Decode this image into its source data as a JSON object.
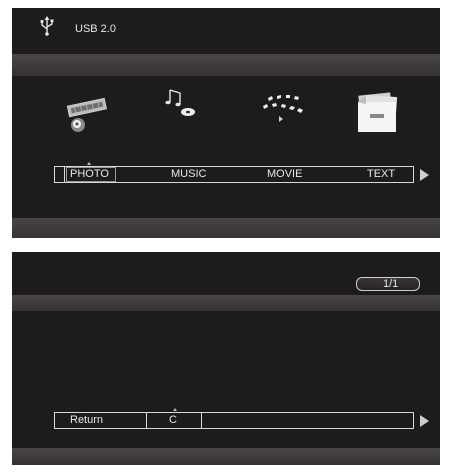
{
  "header": {
    "usb_label": "USB 2.0",
    "usb_icon": "usb-icon"
  },
  "media_menu": {
    "items": [
      {
        "label": "PHOTO",
        "icon": "photo-icon",
        "selected": true
      },
      {
        "label": "MUSIC",
        "icon": "music-icon",
        "selected": false
      },
      {
        "label": "MOVIE",
        "icon": "movie-icon",
        "selected": false
      },
      {
        "label": "TEXT",
        "icon": "text-icon",
        "selected": false
      }
    ],
    "next_icon": "right-arrow-icon"
  },
  "browser": {
    "pager": "1/1",
    "menu": {
      "return_label": "Return",
      "drive_label": "C"
    },
    "next_icon": "right-arrow-icon"
  },
  "colors": {
    "panel": "#1e1b1b",
    "band": "#403c3c",
    "text": "#e8e8e8"
  }
}
